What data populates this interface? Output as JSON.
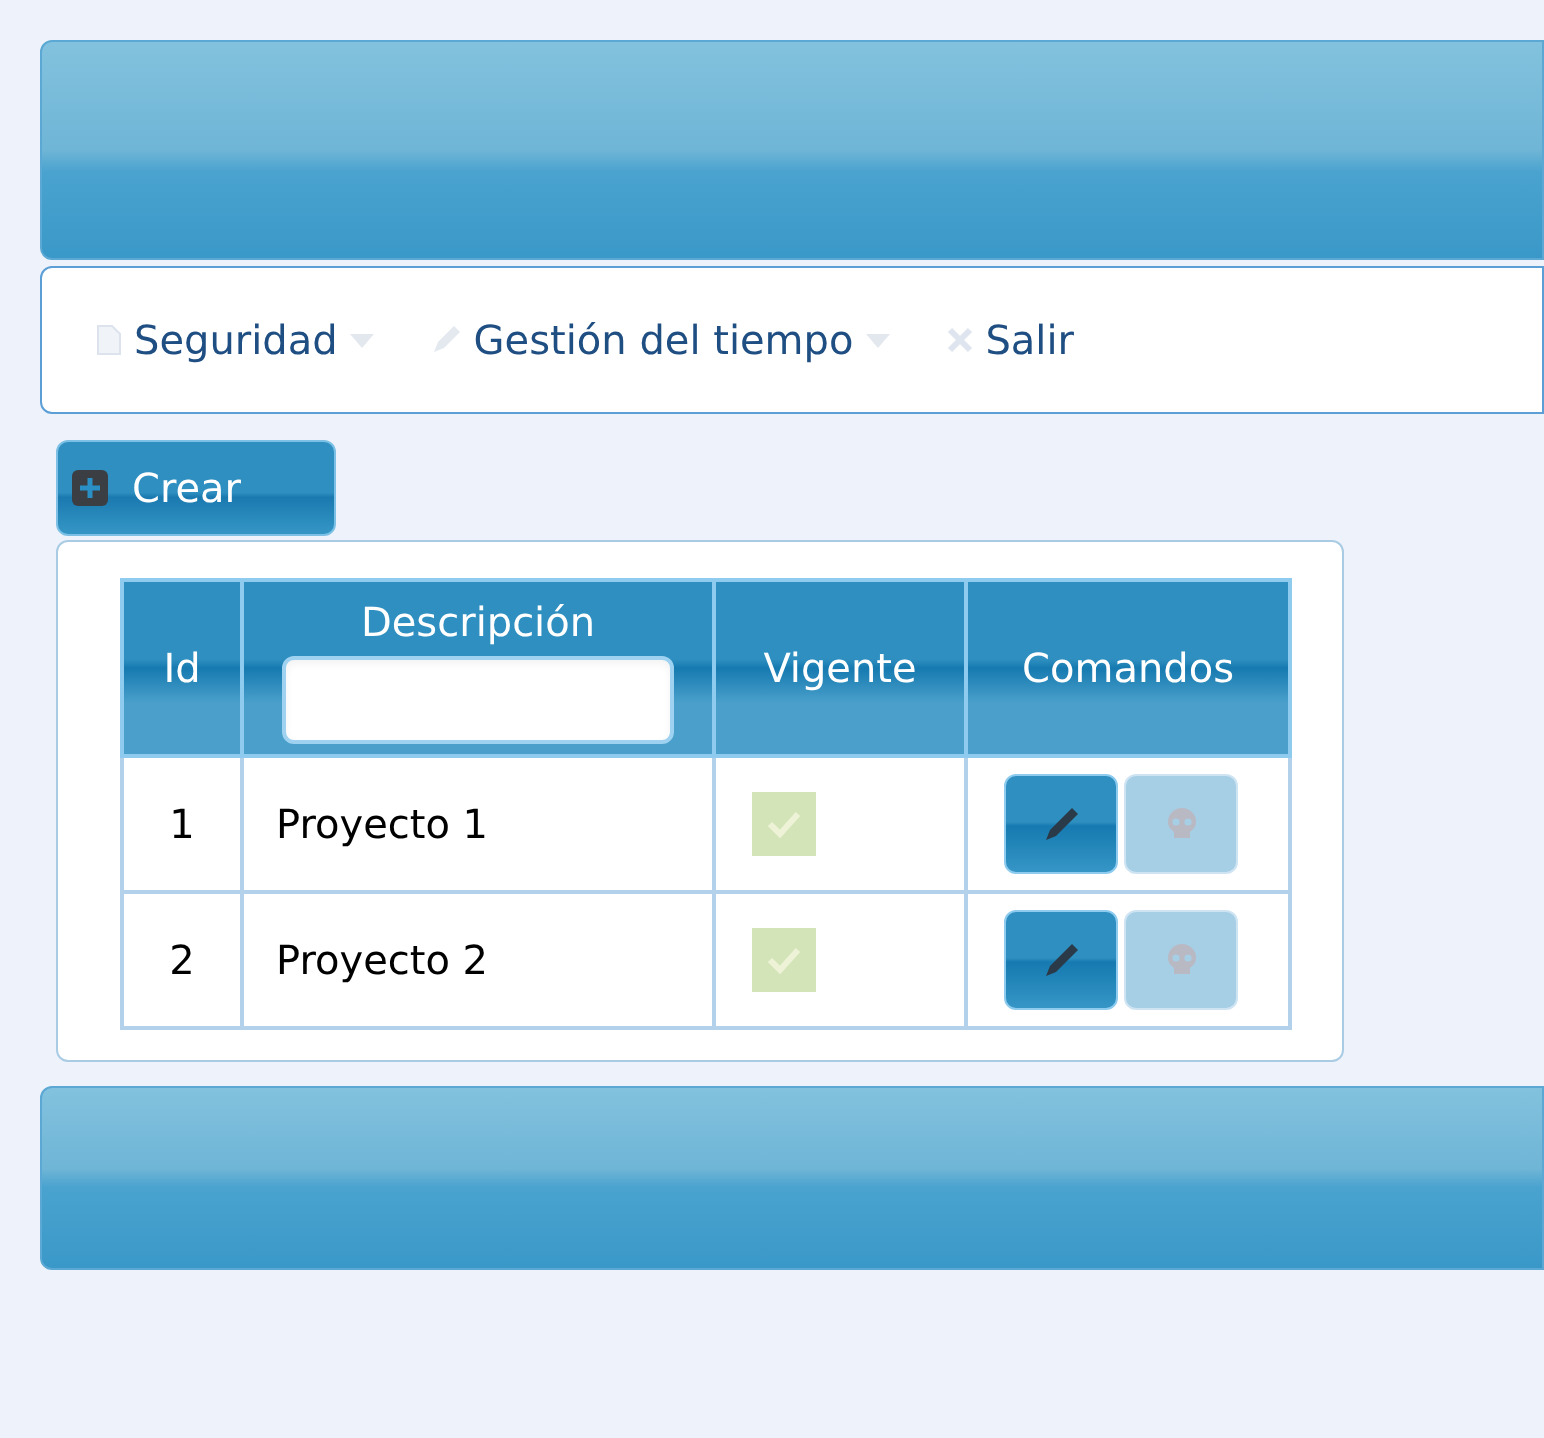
{
  "menu": [
    {
      "label": "Seguridad",
      "kind": "page",
      "dropdown": true
    },
    {
      "label": "Gestión del tiempo",
      "kind": "pencil",
      "dropdown": true
    },
    {
      "label": "Salir",
      "kind": "close",
      "dropdown": false
    }
  ],
  "create_button": {
    "label": "Crear"
  },
  "table": {
    "columns": [
      {
        "label": "Id",
        "filter": false
      },
      {
        "label": "Descripción",
        "filter": true
      },
      {
        "label": "Vigente",
        "filter": false
      },
      {
        "label": "Comandos",
        "filter": false
      }
    ],
    "rows": [
      {
        "id": "1",
        "description": "Proyecto 1",
        "vigente": true,
        "delete_disabled": true
      },
      {
        "id": "2",
        "description": "Proyecto 2",
        "vigente": true,
        "delete_disabled": true
      }
    ]
  }
}
